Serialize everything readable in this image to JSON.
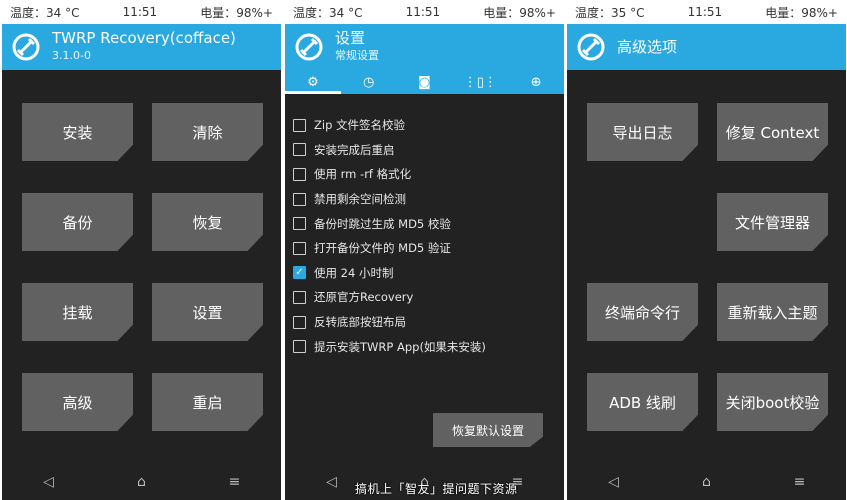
{
  "screen1": {
    "status": {
      "temp": "温度：34 °C",
      "time": "11:51",
      "battery": "电量：98%+"
    },
    "header": {
      "title": "TWRP Recovery(cofface)",
      "subtitle": "3.1.0-0"
    },
    "buttons": [
      "安装",
      "清除",
      "备份",
      "恢复",
      "挂载",
      "设置",
      "高级",
      "重启"
    ]
  },
  "screen2": {
    "status": {
      "temp": "温度：34 °C",
      "time": "11:51",
      "battery": "电量：98%+"
    },
    "header": {
      "title": "设置",
      "subtitle": "常规设置"
    },
    "tabs": [
      {
        "icon": "gear-icon",
        "glyph": "⚙"
      },
      {
        "icon": "clock-icon",
        "glyph": "◷"
      },
      {
        "icon": "screen-icon",
        "glyph": "◙"
      },
      {
        "icon": "vibration-icon",
        "glyph": "⋮▯⋮"
      },
      {
        "icon": "language-icon",
        "glyph": "⊕"
      }
    ],
    "options": [
      {
        "label": "Zip 文件签名校验",
        "checked": false
      },
      {
        "label": "安装完成后重启",
        "checked": false
      },
      {
        "label": "使用 rm -rf 格式化",
        "checked": false
      },
      {
        "label": "禁用剩余空间检测",
        "checked": false
      },
      {
        "label": "备份时跳过生成 MD5 校验",
        "checked": false
      },
      {
        "label": "打开备份文件的 MD5 验证",
        "checked": false
      },
      {
        "label": "使用 24 小时制",
        "checked": true
      },
      {
        "label": "还原官方Recovery",
        "checked": false
      },
      {
        "label": "反转底部按钮布局",
        "checked": false
      },
      {
        "label": "提示安装TWRP App(如果未安装)",
        "checked": false
      }
    ],
    "restore_label": "恢复默认设置"
  },
  "screen3": {
    "status": {
      "temp": "温度：35 °C",
      "time": "11:51",
      "battery": "电量：98%+"
    },
    "header": {
      "title": "高级选项"
    },
    "buttons": [
      "导出日志",
      "修复 Context",
      "",
      "文件管理器",
      "终端命令行",
      "重新载入主题",
      "ADB 线刷",
      "关闭boot校验"
    ]
  },
  "navbar": {
    "back": "◁",
    "home": "⌂",
    "menu": "≡"
  },
  "watermark": "搞机上「智友」提问题下资源"
}
